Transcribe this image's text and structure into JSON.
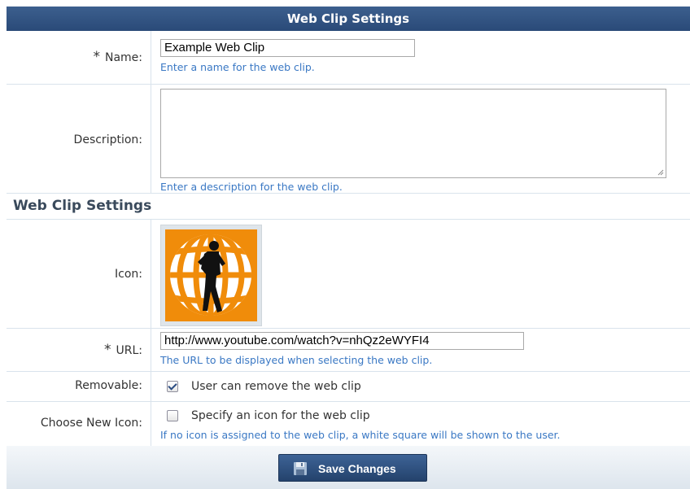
{
  "header": {
    "title": "Web Clip Settings"
  },
  "name_field": {
    "required_mark": "*",
    "label": "Name:",
    "value": "Example Web Clip",
    "hint": "Enter a name for the web clip."
  },
  "description_field": {
    "label": "Description:",
    "value": "",
    "hint": "Enter a description for the web clip."
  },
  "section": {
    "title": "Web Clip Settings"
  },
  "icon_field": {
    "label": "Icon:",
    "icon": "globe-running-figure-icon"
  },
  "url_field": {
    "required_mark": "*",
    "label": "URL:",
    "value": "http://www.youtube.com/watch?v=nhQz2eWYFI4",
    "hint": "The URL to be displayed when selecting the web clip."
  },
  "removable_field": {
    "label": "Removable:",
    "checked": true,
    "checkbox_label": "User can remove the web clip"
  },
  "choose_icon_field": {
    "label": "Choose New Icon:",
    "checked": false,
    "checkbox_label": "Specify an icon for the web clip",
    "hint": "If no icon is assigned to the web clip, a white square will be shown to the user."
  },
  "footer": {
    "save_label": "Save Changes",
    "save_icon": "floppy-disk-icon"
  },
  "colors": {
    "header_bg": "#2f527f",
    "hint_text": "#3a78c4",
    "button_bg": "#2e5080",
    "icon_orange": "#f08c0a"
  }
}
